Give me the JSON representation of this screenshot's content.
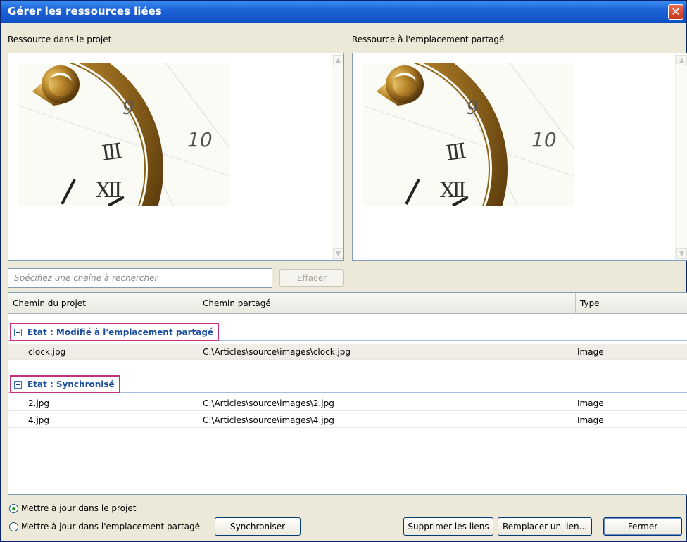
{
  "window": {
    "title": "Gérer les ressources liées",
    "close_glyph": "✕"
  },
  "panes": {
    "left_label": "Ressource dans le projet",
    "right_label": "Ressource à l'emplacement partagé"
  },
  "search": {
    "placeholder": "Spécifiez une chaîne à rechercher",
    "clear_label": "Effacer"
  },
  "table": {
    "columns": [
      "Chemin du projet",
      "Chemin partagé",
      "Type"
    ],
    "groups": [
      {
        "title": "Etat : Modifié à l'emplacement partagé",
        "rows": [
          {
            "project": "clock.jpg",
            "shared": "C:\\Articles\\source\\images\\clock.jpg",
            "type": "Image"
          }
        ]
      },
      {
        "title": "Etat : Synchronisé",
        "rows": [
          {
            "project": "2.jpg",
            "shared": "C:\\Articles\\source\\images\\2.jpg",
            "type": "Image"
          },
          {
            "project": "4.jpg",
            "shared": "C:\\Articles\\source\\images\\4.jpg",
            "type": "Image"
          }
        ]
      }
    ]
  },
  "options": {
    "update_project": "Mettre à jour dans le projet",
    "update_shared": "Mettre à jour dans l'emplacement partagé",
    "selected": "update_project"
  },
  "buttons": {
    "sync": "Synchroniser",
    "delete_links": "Supprimer les liens",
    "replace_link": "Remplacer un lien...",
    "close": "Fermer"
  },
  "colors": {
    "title_bar": "#1d64d8",
    "group_highlight": "#c2317c",
    "group_text": "#1b4f9e"
  },
  "icons": {
    "close": "close-icon",
    "scroll_up": "chevron-up-icon",
    "scroll_down": "chevron-down-icon",
    "collapse": "collapse-icon",
    "radio": "radio-icon"
  },
  "clock_numbers": [
    "9",
    "10"
  ]
}
